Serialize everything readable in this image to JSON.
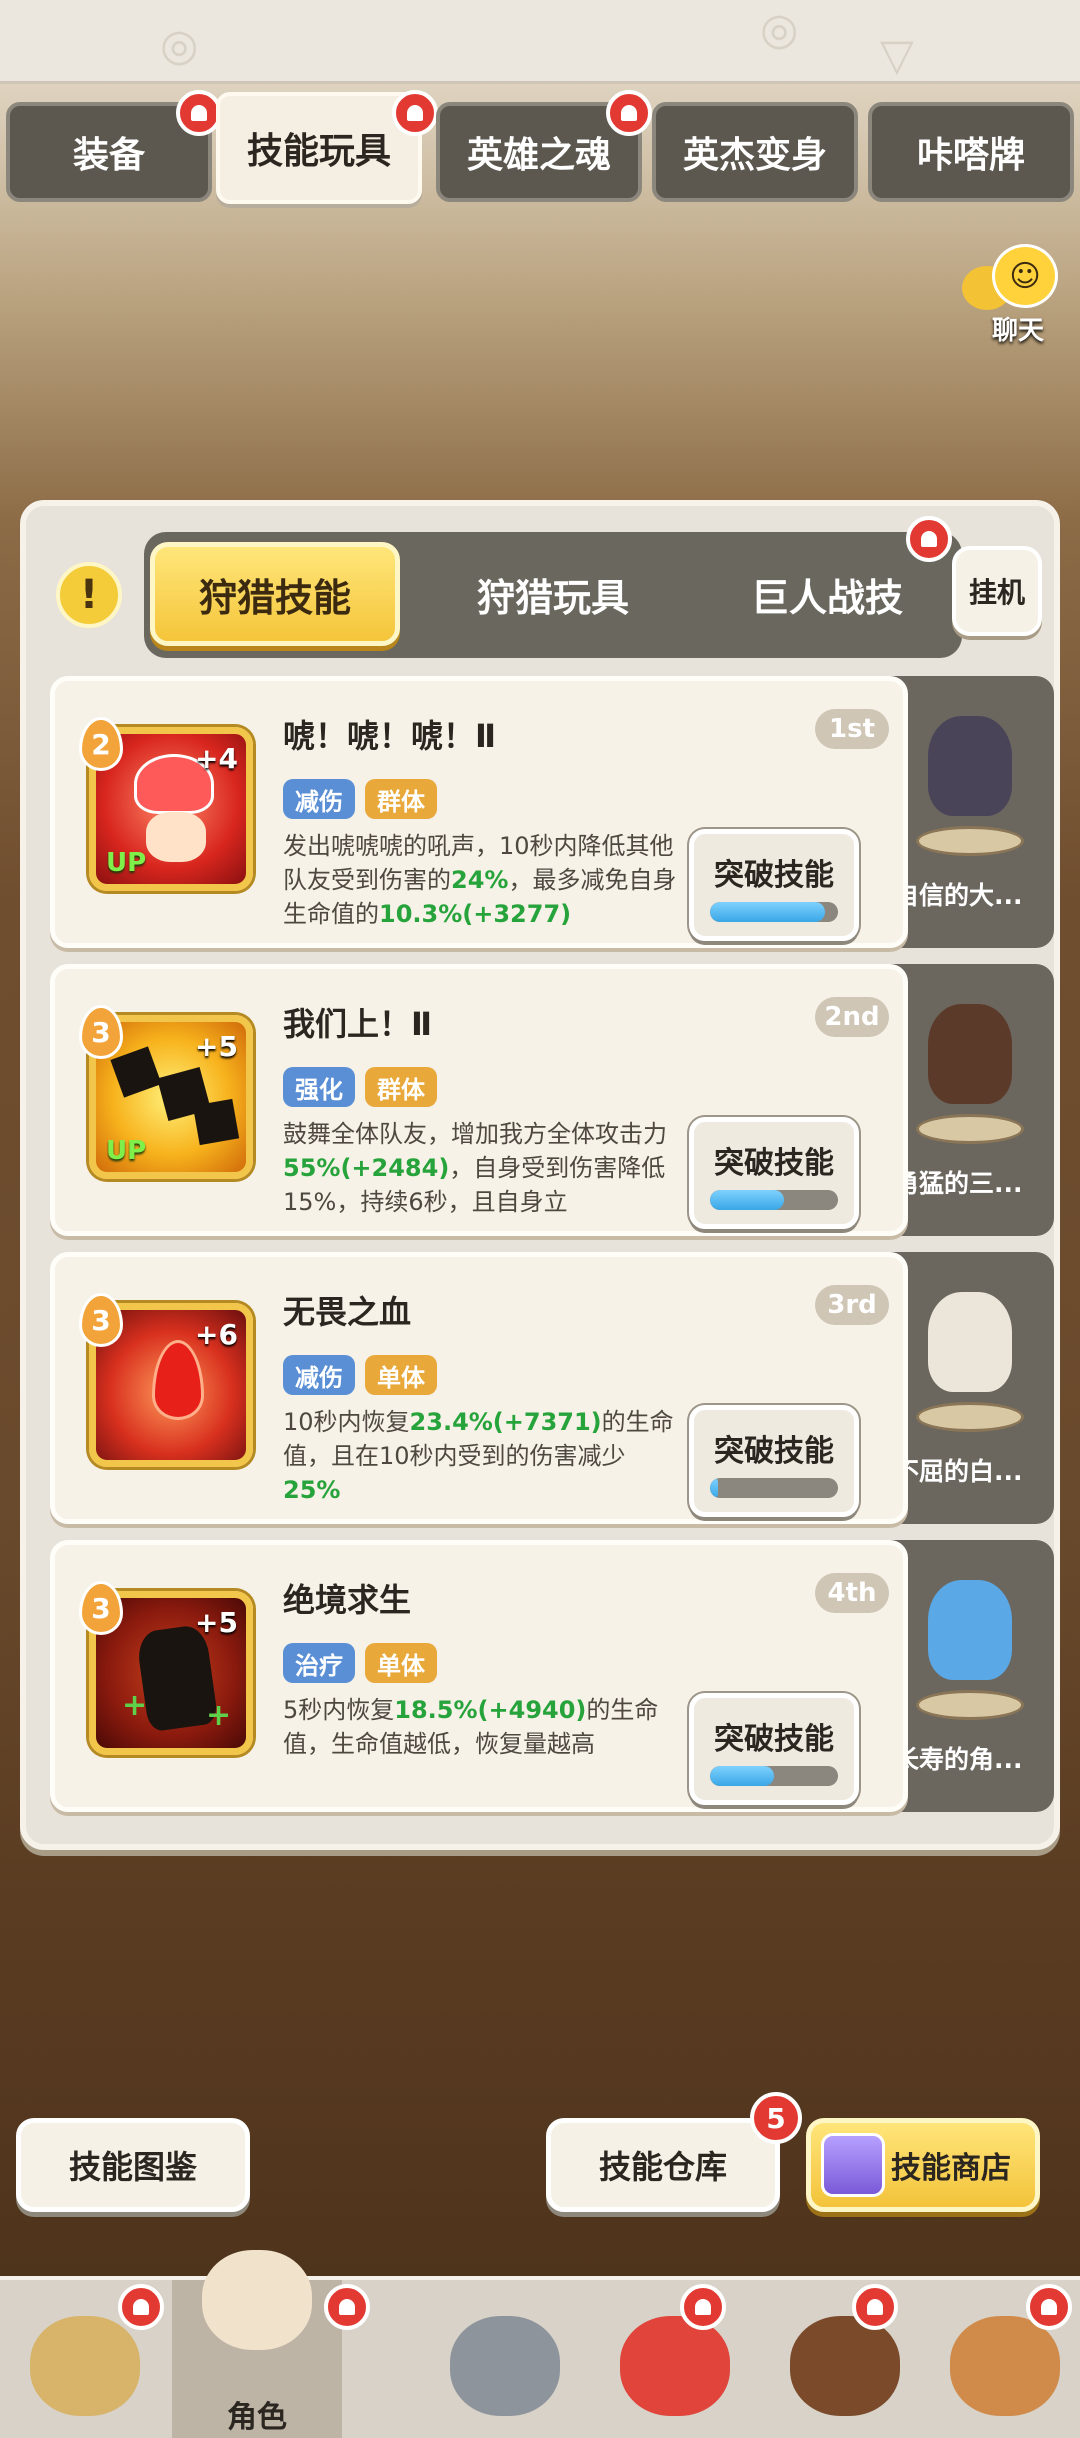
{
  "top_tabs": [
    {
      "label": "装备",
      "active": false,
      "badge": true
    },
    {
      "label": "技能玩具",
      "active": true,
      "badge": true
    },
    {
      "label": "英雄之魂",
      "active": false,
      "badge": true
    },
    {
      "label": "英杰变身",
      "active": false,
      "badge": false
    },
    {
      "label": "咔嗒牌",
      "active": false,
      "badge": false
    }
  ],
  "chat": {
    "label": "聊天"
  },
  "panel": {
    "info_icon": "!",
    "sub_tabs": [
      {
        "label": "狩猎技能",
        "active": true
      },
      {
        "label": "狩猎玩具",
        "active": false
      },
      {
        "label": "巨人战技",
        "active": false
      }
    ],
    "idle_button": "挂机"
  },
  "skills": [
    {
      "title": "唬！唬！唬！Ⅱ",
      "rank": "1st",
      "level": "2",
      "plus": "+4",
      "up": "UP",
      "tags": [
        "减伤",
        "群体"
      ],
      "desc_parts": [
        "发出唬唬唬的吼声，10秒内降低其他队友受到伤害的",
        "24%",
        "，最多减免自身生命值的",
        "10.3%(+3277)",
        "..."
      ],
      "button": "突破技能",
      "progress": 0.9,
      "pet_name": "自信的大...",
      "icon": "roaring-face-icon"
    },
    {
      "title": "我们上！Ⅱ",
      "rank": "2nd",
      "level": "3",
      "plus": "+5",
      "up": "UP",
      "tags": [
        "强化",
        "群体"
      ],
      "desc_parts": [
        "鼓舞全体队友，增加我方全体攻击力",
        "55%(+2484)",
        "，自身受到伤害降低15%，持续6秒，且自身立",
        "...",
        ""
      ],
      "button": "突破技能",
      "progress": 0.58,
      "pet_name": "勇猛的三...",
      "icon": "charging-crowd-icon"
    },
    {
      "title": "无畏之血",
      "rank": "3rd",
      "level": "3",
      "plus": "+6",
      "up": "",
      "tags": [
        "减伤",
        "单体"
      ],
      "desc_parts": [
        "10秒内恢复",
        "23.4%(+7371)",
        "的生命值，且在10秒内受到的伤害减少",
        "25%",
        ""
      ],
      "button": "突破技能",
      "progress": 0.06,
      "pet_name": "不屈的白...",
      "icon": "blood-drop-icon"
    },
    {
      "title": "绝境求生",
      "rank": "4th",
      "level": "3",
      "plus": "+5",
      "up": "",
      "tags": [
        "治疗",
        "单体"
      ],
      "desc_parts": [
        "5秒内恢复",
        "18.5%(+4940)",
        "的生命值，生命值越低，恢复量越高",
        "",
        ""
      ],
      "button": "突破技能",
      "progress": 0.5,
      "pet_name": "长寿的角...",
      "icon": "healing-figure-icon"
    }
  ],
  "bottom_buttons": {
    "codex": "技能图鉴",
    "warehouse": "技能仓库",
    "warehouse_count": "5",
    "shop": "技能商店"
  },
  "bottom_nav": [
    {
      "label": "",
      "icon": "caveman-avatar-icon",
      "badge": true
    },
    {
      "label": "角色",
      "icon": "hero-avatar-icon",
      "badge": true,
      "active": true
    },
    {
      "label": "",
      "icon": "sword-shield-icon",
      "badge": false
    },
    {
      "label": "",
      "icon": "red-dino-icon",
      "badge": true
    },
    {
      "label": "",
      "icon": "bear-pet-icon",
      "badge": true
    },
    {
      "label": "",
      "icon": "stone-golem-icon",
      "badge": true
    }
  ],
  "colors": {
    "accent_gold": "#f5c53a",
    "progress_blue": "#39a7e6",
    "highlight_green": "#27a33b",
    "badge_red": "#e23a32"
  }
}
